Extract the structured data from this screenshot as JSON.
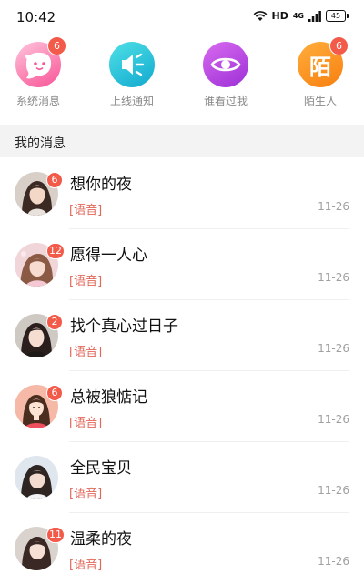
{
  "status_bar": {
    "time": "10:42",
    "network": "HD",
    "signal": "4G",
    "battery": "45"
  },
  "shortcuts": [
    {
      "label": "系统消息",
      "badge": "6",
      "icon": "heart-face-icon"
    },
    {
      "label": "上线通知",
      "badge": "",
      "icon": "speaker-icon"
    },
    {
      "label": "谁看过我",
      "badge": "",
      "icon": "eye-icon"
    },
    {
      "label": "陌生人",
      "badge": "6",
      "icon": "stranger-icon",
      "glyph": "陌"
    }
  ],
  "section": {
    "title": "我的消息"
  },
  "messages": [
    {
      "name": "想你的夜",
      "badge": "6",
      "preview": "[语音]",
      "time": "11-26"
    },
    {
      "name": "愿得一人心",
      "badge": "12",
      "preview": "[语音]",
      "time": "11-26"
    },
    {
      "name": "找个真心过日子",
      "badge": "2",
      "preview": "[语音]",
      "time": "11-26"
    },
    {
      "name": "总被狼惦记",
      "badge": "6",
      "preview": "[语音]",
      "time": "11-26"
    },
    {
      "name": "全民宝贝",
      "badge": "",
      "preview": "[语音]",
      "time": "11-26"
    },
    {
      "name": "温柔的夜",
      "badge": "11",
      "preview": "[语音]",
      "time": "11-26"
    }
  ],
  "colors": {
    "accent_badge": "#f25a4a",
    "preview_text": "#e0685a",
    "section_bg": "#f3f3f3"
  }
}
